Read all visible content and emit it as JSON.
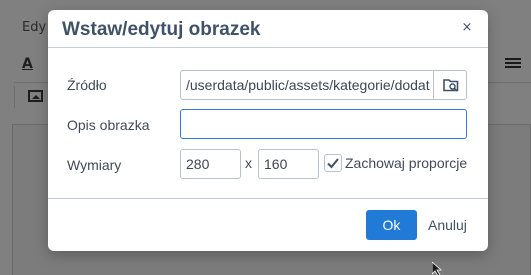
{
  "background": {
    "menu_item": "Edy"
  },
  "dialog": {
    "title": "Wstaw/edytuj obrazek",
    "close_label": "×",
    "source": {
      "label": "Źródło",
      "value": "/userdata/public/assets/kategorie/dodat"
    },
    "description": {
      "label": "Opis obrazka",
      "value": ""
    },
    "dimensions": {
      "label": "Wymiary",
      "width": "280",
      "separator": "x",
      "height": "160",
      "constrain_label": "Zachowaj proporcje",
      "constrain_checked": true
    },
    "ok_label": "Ok",
    "cancel_label": "Anuluj"
  },
  "colors": {
    "accent": "#207ad6",
    "title": "#3f5268",
    "overlay": "#808080"
  },
  "icons": {
    "browse": "folder-search-icon",
    "close": "close-icon",
    "check": "check-icon"
  }
}
